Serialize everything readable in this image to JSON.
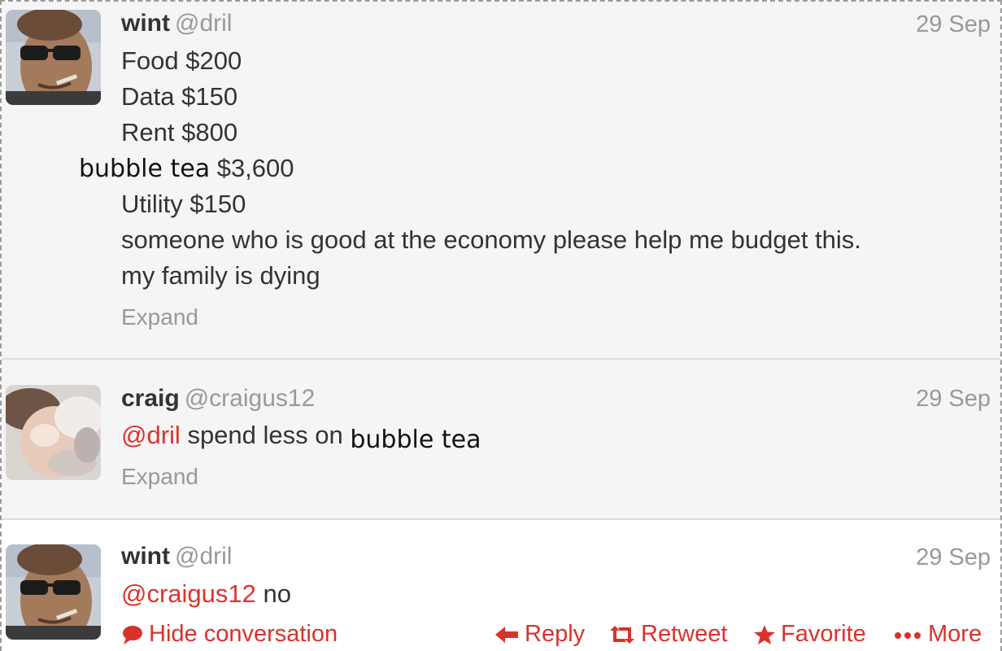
{
  "tweets": [
    {
      "author": "wint",
      "handle": "@dril",
      "date": "29 Sep",
      "lines": [
        "Food $200",
        "Data $150",
        "Rent $800"
      ],
      "overlay_label": "bubble tea",
      "overlay_amount": "$3,600",
      "lines_after": [
        "Utility $150",
        "someone who is good at the economy please help me budget this.",
        "my family is dying"
      ],
      "expand": "Expand"
    },
    {
      "author": "craig",
      "handle": "@craigus12",
      "date": "29 Sep",
      "mention": "@dril",
      "text": "spend less on",
      "overlay_label": "bubble tea",
      "expand": "Expand"
    },
    {
      "author": "wint",
      "handle": "@dril",
      "date": "29 Sep",
      "mention": "@craigus12",
      "text": "no"
    }
  ],
  "actions": {
    "hide_conversation": "Hide conversation",
    "reply": "Reply",
    "retweet": "Retweet",
    "favorite": "Favorite",
    "more": "More"
  },
  "colors": {
    "accent": "#d9322c",
    "muted": "#999999",
    "text": "#333333",
    "tweet_bg": "#f5f5f5"
  },
  "icons": [
    "speech-bubble-icon",
    "reply-arrow-icon",
    "retweet-icon",
    "star-icon",
    "ellipsis-icon"
  ]
}
